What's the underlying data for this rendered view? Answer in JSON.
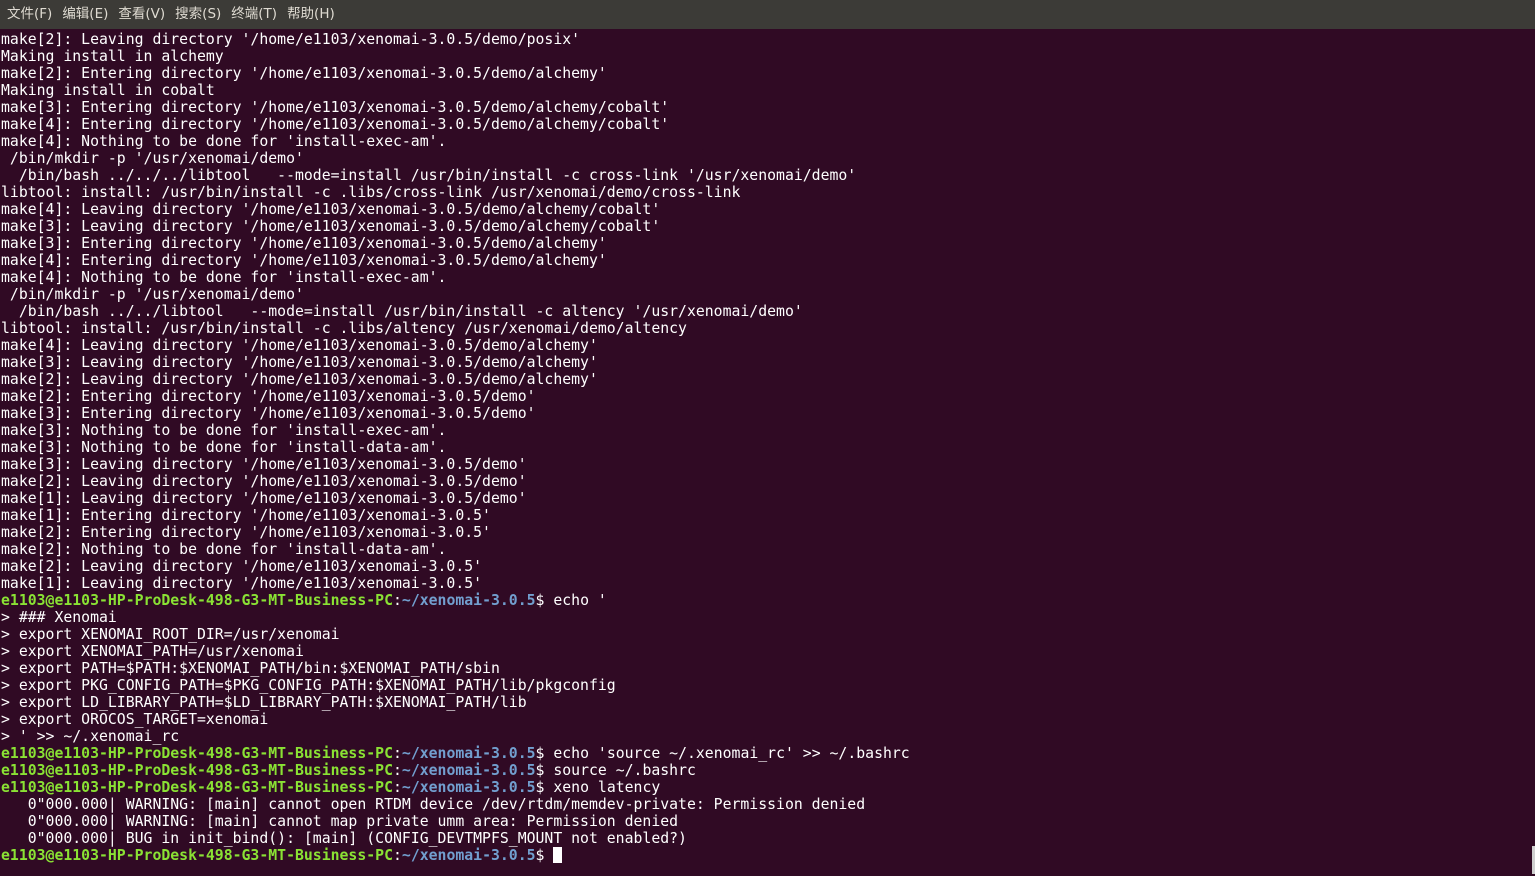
{
  "menubar": {
    "items": [
      "文件(F)",
      "编辑(E)",
      "查看(V)",
      "搜索(S)",
      "终端(T)",
      "帮助(H)"
    ]
  },
  "terminal": {
    "lines": [
      {
        "type": "out",
        "text": "make[2]: Leaving directory '/home/e1103/xenomai-3.0.5/demo/posix'"
      },
      {
        "type": "out",
        "text": "Making install in alchemy"
      },
      {
        "type": "out",
        "text": "make[2]: Entering directory '/home/e1103/xenomai-3.0.5/demo/alchemy'"
      },
      {
        "type": "out",
        "text": "Making install in cobalt"
      },
      {
        "type": "out",
        "text": "make[3]: Entering directory '/home/e1103/xenomai-3.0.5/demo/alchemy/cobalt'"
      },
      {
        "type": "out",
        "text": "make[4]: Entering directory '/home/e1103/xenomai-3.0.5/demo/alchemy/cobalt'"
      },
      {
        "type": "out",
        "text": "make[4]: Nothing to be done for 'install-exec-am'."
      },
      {
        "type": "out",
        "text": " /bin/mkdir -p '/usr/xenomai/demo'"
      },
      {
        "type": "out",
        "text": "  /bin/bash ../../../libtool   --mode=install /usr/bin/install -c cross-link '/usr/xenomai/demo'"
      },
      {
        "type": "out",
        "text": "libtool: install: /usr/bin/install -c .libs/cross-link /usr/xenomai/demo/cross-link"
      },
      {
        "type": "out",
        "text": "make[4]: Leaving directory '/home/e1103/xenomai-3.0.5/demo/alchemy/cobalt'"
      },
      {
        "type": "out",
        "text": "make[3]: Leaving directory '/home/e1103/xenomai-3.0.5/demo/alchemy/cobalt'"
      },
      {
        "type": "out",
        "text": "make[3]: Entering directory '/home/e1103/xenomai-3.0.5/demo/alchemy'"
      },
      {
        "type": "out",
        "text": "make[4]: Entering directory '/home/e1103/xenomai-3.0.5/demo/alchemy'"
      },
      {
        "type": "out",
        "text": "make[4]: Nothing to be done for 'install-exec-am'."
      },
      {
        "type": "out",
        "text": " /bin/mkdir -p '/usr/xenomai/demo'"
      },
      {
        "type": "out",
        "text": "  /bin/bash ../../libtool   --mode=install /usr/bin/install -c altency '/usr/xenomai/demo'"
      },
      {
        "type": "out",
        "text": "libtool: install: /usr/bin/install -c .libs/altency /usr/xenomai/demo/altency"
      },
      {
        "type": "out",
        "text": "make[4]: Leaving directory '/home/e1103/xenomai-3.0.5/demo/alchemy'"
      },
      {
        "type": "out",
        "text": "make[3]: Leaving directory '/home/e1103/xenomai-3.0.5/demo/alchemy'"
      },
      {
        "type": "out",
        "text": "make[2]: Leaving directory '/home/e1103/xenomai-3.0.5/demo/alchemy'"
      },
      {
        "type": "out",
        "text": "make[2]: Entering directory '/home/e1103/xenomai-3.0.5/demo'"
      },
      {
        "type": "out",
        "text": "make[3]: Entering directory '/home/e1103/xenomai-3.0.5/demo'"
      },
      {
        "type": "out",
        "text": "make[3]: Nothing to be done for 'install-exec-am'."
      },
      {
        "type": "out",
        "text": "make[3]: Nothing to be done for 'install-data-am'."
      },
      {
        "type": "out",
        "text": "make[3]: Leaving directory '/home/e1103/xenomai-3.0.5/demo'"
      },
      {
        "type": "out",
        "text": "make[2]: Leaving directory '/home/e1103/xenomai-3.0.5/demo'"
      },
      {
        "type": "out",
        "text": "make[1]: Leaving directory '/home/e1103/xenomai-3.0.5/demo'"
      },
      {
        "type": "out",
        "text": "make[1]: Entering directory '/home/e1103/xenomai-3.0.5'"
      },
      {
        "type": "out",
        "text": "make[2]: Entering directory '/home/e1103/xenomai-3.0.5'"
      },
      {
        "type": "out",
        "text": "make[2]: Nothing to be done for 'install-data-am'."
      },
      {
        "type": "out",
        "text": "make[2]: Leaving directory '/home/e1103/xenomai-3.0.5'"
      },
      {
        "type": "out",
        "text": "make[1]: Leaving directory '/home/e1103/xenomai-3.0.5'"
      },
      {
        "type": "prompt",
        "user": "e1103@e1103-HP-ProDesk-498-G3-MT-Business-PC",
        "sep": ":",
        "path": "~/xenomai-3.0.5",
        "cmd": "$ echo '"
      },
      {
        "type": "out",
        "text": "> ### Xenomai"
      },
      {
        "type": "out",
        "text": "> export XENOMAI_ROOT_DIR=/usr/xenomai"
      },
      {
        "type": "out",
        "text": "> export XENOMAI_PATH=/usr/xenomai"
      },
      {
        "type": "out",
        "text": "> export PATH=$PATH:$XENOMAI_PATH/bin:$XENOMAI_PATH/sbin"
      },
      {
        "type": "out",
        "text": "> export PKG_CONFIG_PATH=$PKG_CONFIG_PATH:$XENOMAI_PATH/lib/pkgconfig"
      },
      {
        "type": "out",
        "text": "> export LD_LIBRARY_PATH=$LD_LIBRARY_PATH:$XENOMAI_PATH/lib"
      },
      {
        "type": "out",
        "text": "> export OROCOS_TARGET=xenomai"
      },
      {
        "type": "out",
        "text": "> ' >> ~/.xenomai_rc"
      },
      {
        "type": "prompt",
        "user": "e1103@e1103-HP-ProDesk-498-G3-MT-Business-PC",
        "sep": ":",
        "path": "~/xenomai-3.0.5",
        "cmd": "$ echo 'source ~/.xenomai_rc' >> ~/.bashrc"
      },
      {
        "type": "prompt",
        "user": "e1103@e1103-HP-ProDesk-498-G3-MT-Business-PC",
        "sep": ":",
        "path": "~/xenomai-3.0.5",
        "cmd": "$ source ~/.bashrc"
      },
      {
        "type": "prompt",
        "user": "e1103@e1103-HP-ProDesk-498-G3-MT-Business-PC",
        "sep": ":",
        "path": "~/xenomai-3.0.5",
        "cmd": "$ xeno latency"
      },
      {
        "type": "out",
        "text": "   0\"000.000| WARNING: [main] cannot open RTDM device /dev/rtdm/memdev-private: Permission denied"
      },
      {
        "type": "out",
        "text": "   0\"000.000| WARNING: [main] cannot map private umm area: Permission denied"
      },
      {
        "type": "out",
        "text": "   0\"000.000| BUG in init_bind(): [main] (CONFIG_DEVTMPFS_MOUNT not enabled?)"
      },
      {
        "type": "prompt",
        "user": "e1103@e1103-HP-ProDesk-498-G3-MT-Business-PC",
        "sep": ":",
        "path": "~/xenomai-3.0.5",
        "cmd": "$ ",
        "cursor": true
      }
    ]
  },
  "colors": {
    "background": "#300a24",
    "menubar": "#3c3b37",
    "prompt_user": "#8ae234",
    "prompt_path": "#729fcf",
    "text": "#ffffff"
  }
}
